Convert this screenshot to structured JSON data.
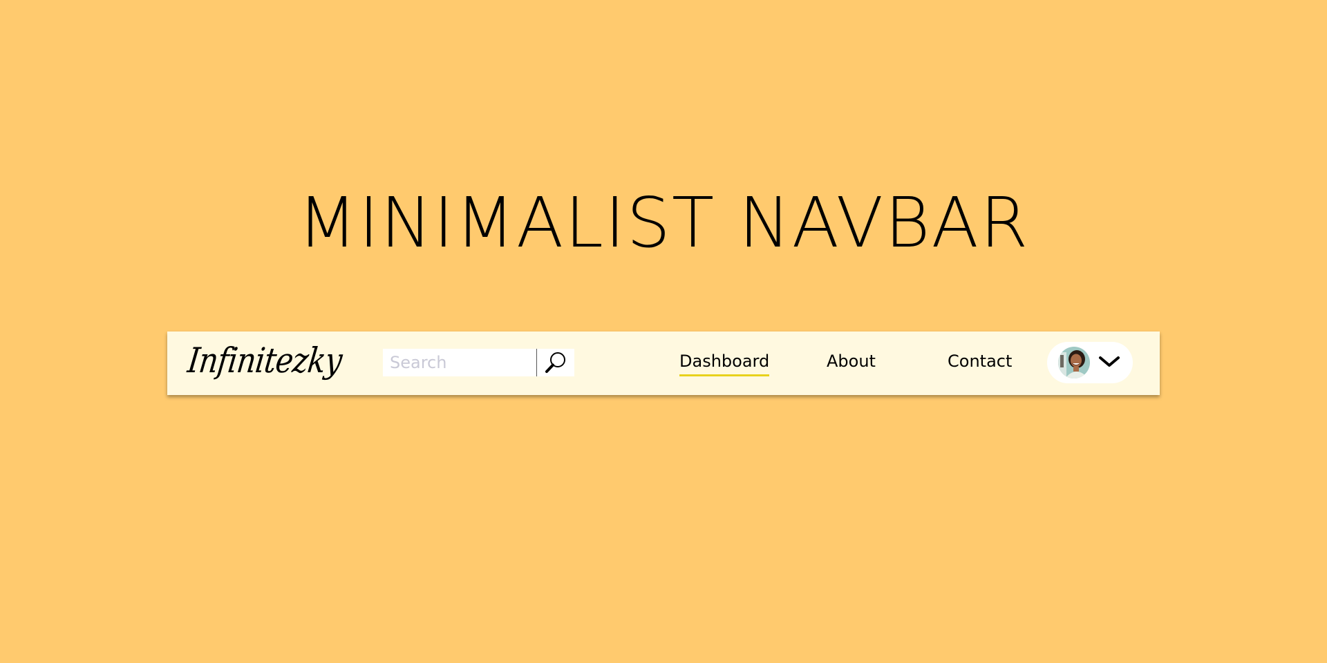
{
  "page": {
    "title": "MINIMALIST NAVBAR",
    "background_color": "#ffca6e"
  },
  "navbar": {
    "background_color": "#fff9e0",
    "logo_text": "Infinitezky",
    "search": {
      "placeholder": "Search",
      "value": "",
      "icon": "search-icon"
    },
    "links": [
      {
        "label": "Dashboard",
        "active": true
      },
      {
        "label": "About",
        "active": false
      },
      {
        "label": "Contact",
        "active": false
      }
    ],
    "active_underline_color": "#e8d21c",
    "profile": {
      "avatar": "avatar",
      "icon": "chevron-down-icon"
    }
  }
}
